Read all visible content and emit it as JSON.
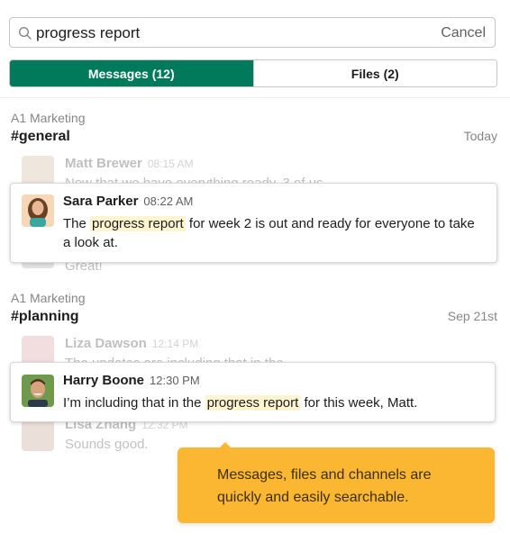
{
  "search": {
    "query": "progress report",
    "cancel_label": "Cancel"
  },
  "tabs": [
    {
      "label": "Messages (12)",
      "active": true
    },
    {
      "label": "Files (2)",
      "active": false
    }
  ],
  "colors": {
    "accent": "#007a5a",
    "highlight": "#fff4d0",
    "tooltip": "#fbb731"
  },
  "results": [
    {
      "team": "A1 Marketing",
      "channel": "#general",
      "date": "Today",
      "faded_before": {
        "name": "Matt Brewer",
        "time": "08:15 AM",
        "text": "Now that we have everything ready, 3 of us"
      },
      "match": {
        "name": "Sara Parker",
        "time": "08:22 AM",
        "text_before": "The ",
        "highlight": "progress report",
        "text_after": " for week 2 is out and ready for everyone to take a look at."
      },
      "faded_after": {
        "text": "Great!"
      }
    },
    {
      "team": "A1 Marketing",
      "channel": "#planning",
      "date": "Sep 21st",
      "faded_before": {
        "name": "Liza Dawson",
        "time": "12:14 PM",
        "text": "The updates are including that in the"
      },
      "match": {
        "name": "Harry Boone",
        "time": "12:30 PM",
        "text_before": "I’m including that in the ",
        "highlight": "progress report",
        "text_after": " for this week, Matt."
      },
      "faded_after": {
        "name": "Lisa Zhang",
        "time": "12:32 PM",
        "text": "Sounds good."
      }
    }
  ],
  "tooltip": {
    "text": "Messages, files and channels are quickly and easily searchable."
  }
}
